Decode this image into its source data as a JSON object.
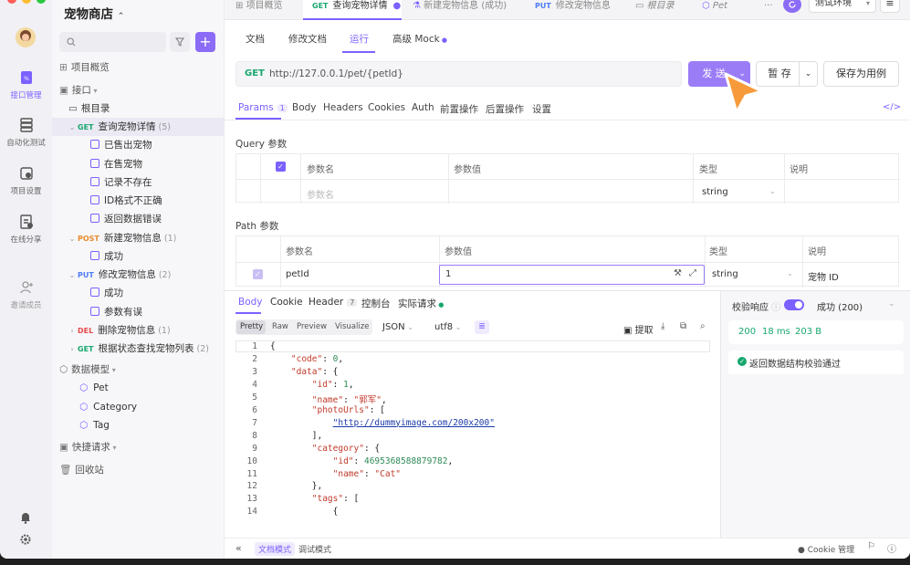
{
  "project": {
    "name": "宠物商店"
  },
  "rail": {
    "items": [
      {
        "label": "接口管理",
        "icon": "api-icon"
      },
      {
        "label": "自动化测试",
        "icon": "automation-icon"
      },
      {
        "label": "项目设置",
        "icon": "settings-icon"
      },
      {
        "label": "在线分享",
        "icon": "share-icon"
      },
      {
        "label": "邀请成员",
        "icon": "invite-icon"
      }
    ]
  },
  "sidebar": {
    "search_placeholder": "",
    "overview": "项目概览",
    "api_section": "接口",
    "root": "根目录",
    "tree": [
      {
        "method": "GET",
        "label": "查询宠物详情",
        "count": "(5)"
      },
      {
        "case": "已售出宠物"
      },
      {
        "case": "在售宠物"
      },
      {
        "case": "记录不存在"
      },
      {
        "case": "ID格式不正确"
      },
      {
        "case": "返回数据错误"
      },
      {
        "method": "POST",
        "label": "新建宠物信息",
        "count": "(1)"
      },
      {
        "case": "成功"
      },
      {
        "method": "PUT",
        "label": "修改宠物信息",
        "count": "(2)"
      },
      {
        "case": "成功"
      },
      {
        "case": "参数有误"
      },
      {
        "method": "DEL",
        "label": "删除宠物信息",
        "count": "(1)"
      },
      {
        "method": "GET",
        "label": "根据状态查找宠物列表",
        "count": "(2)"
      }
    ],
    "schemas_label": "数据模型",
    "schemas": [
      "Pet",
      "Category",
      "Tag"
    ],
    "quick_label": "快捷请求",
    "trash_label": "回收站"
  },
  "tabs": [
    {
      "label": "项目概览"
    },
    {
      "method": "GET",
      "label": "查询宠物详情"
    },
    {
      "label": "新建宠物信息 (成功)"
    },
    {
      "method": "PUT",
      "label": "修改宠物信息"
    },
    {
      "label": "根目录"
    },
    {
      "label": "Pet"
    }
  ],
  "env": {
    "label": "测试环境"
  },
  "subtabs": [
    "文档",
    "修改文档",
    "运行",
    "高级 Mock"
  ],
  "request": {
    "method": "GET",
    "url": "http://127.0.0.1/pet/{petId}",
    "send": "发 送",
    "save_temp": "暂 存",
    "save_case": "保存为用例"
  },
  "param_tabs": [
    "Params",
    "Body",
    "Headers",
    "Cookies",
    "Auth",
    "前置操作",
    "后置操作",
    "设置"
  ],
  "params_count": "1",
  "query": {
    "title": "Query 参数",
    "headers": [
      "参数名",
      "参数值",
      "类型",
      "说明"
    ],
    "row": {
      "name_placeholder": "参数名",
      "type": "string"
    }
  },
  "path": {
    "title": "Path 参数",
    "headers": [
      "参数名",
      "参数值",
      "类型",
      "说明"
    ],
    "row": {
      "name": "petId",
      "value": "1",
      "type": "string",
      "desc": "宠物 ID"
    }
  },
  "response": {
    "tabs": [
      "Body",
      "Cookie",
      "Header",
      "控制台",
      "实际请求"
    ],
    "header_count": "7",
    "views": [
      "Pretty",
      "Raw",
      "Preview",
      "Visualize"
    ],
    "format": "JSON",
    "encoding": "utf8",
    "extract": "提取",
    "code_lines": [
      "{",
      "    \"code\": 0,",
      "    \"data\": {",
      "        \"id\": 1,",
      "        \"name\": \"郭军\",",
      "        \"photoUrls\": [",
      "            \"http://dummyimage.com/200x200\"",
      "        ],",
      "        \"category\": {",
      "            \"id\": 4695368588879782,",
      "            \"name\": \"Cat\"",
      "        },",
      "        \"tags\": [",
      "            {"
    ],
    "line_numbers": [
      "1",
      "2",
      "3",
      "4",
      "5",
      "6",
      "7",
      "8",
      "9",
      "10",
      "11",
      "12",
      "13",
      "14"
    ]
  },
  "validation": {
    "label": "校验响应",
    "result": "成功 (200)",
    "status": "200",
    "time": "18 ms",
    "size": "203 B",
    "message": "返回数据结构校验通过"
  },
  "footer": {
    "doc_mode": "文档模式",
    "debug_mode": "调试模式",
    "cookie": "Cookie 管理"
  },
  "colors": {
    "accent": "#7b61ff",
    "send": "#9b7cf7",
    "success": "#17a76e",
    "cursor": "#f79a3a"
  }
}
